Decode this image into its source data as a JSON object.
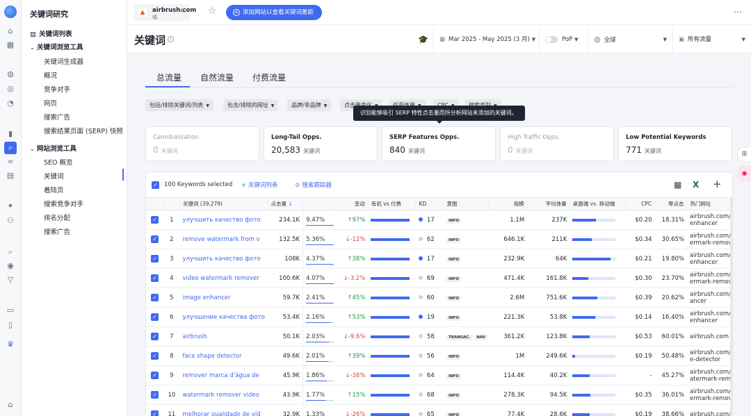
{
  "rail": {
    "icons": [
      "home-icon",
      "grid-icon",
      "globe-icon",
      "compass-icon",
      "pie-icon",
      "chart-icon",
      "keyword-icon",
      "link-icon",
      "doc-icon",
      "sparkle-icon",
      "group-icon",
      "search-zoom-icon",
      "target-icon",
      "funnel-icon",
      "report-icon",
      "clipboard-icon",
      "crown-icon",
      "settings-icon"
    ]
  },
  "sidenav": {
    "title": "关键词研究",
    "list_label": "关键词列表",
    "kw_tools": "关键词浏览工具",
    "kw_items": [
      "关键词生成器",
      "概况",
      "竞争对手",
      "网页",
      "搜索广告",
      "搜索结果页面 (SERP) 快照"
    ],
    "site_tools": "网站浏览工具",
    "site_items": [
      "SEO 概览",
      "关键词",
      "着陆页",
      "搜索竞争对手",
      "排名分配",
      "搜索广告"
    ]
  },
  "topbar": {
    "domain": "airbrush.com",
    "domain_sub": "域",
    "add_button": "添加网站以查看关键词差距"
  },
  "header": {
    "title": "关键词",
    "date_range": "Mar 2025 - May 2025 (3 月)",
    "pop": "PoP",
    "region": "全球",
    "traffic": "所有流量"
  },
  "tabs": [
    "总流量",
    "自然流量",
    "付费流量"
  ],
  "filters": [
    "包括/排除关键词/列表",
    "包含/排除的网址",
    "品牌/非品牌",
    "点击量变化",
    "任意体量",
    "CPC",
    "搜索类别"
  ],
  "tooltip": "识别能够吸引 SERP 特性点击量而所分析网站未添加的关键词。",
  "cards": [
    {
      "label": "Cannibalization",
      "value": "0",
      "unit": "关键词",
      "dim": true
    },
    {
      "label": "Long-Tail Opps.",
      "value": "20,583",
      "unit": "关键词",
      "dim": false
    },
    {
      "label": "SERP Features Opps.",
      "value": "840",
      "unit": "关键词",
      "dim": false
    },
    {
      "label": "High Traffic Opps.",
      "value": "0",
      "unit": "关键词",
      "dim": true
    },
    {
      "label": "Low Potential Keywords",
      "value": "771",
      "unit": "关键词",
      "dim": false
    }
  ],
  "toolbar": {
    "selected": "100 Keywords selected",
    "kw_list": "关键词列表",
    "tracker": "搜索跟踪器"
  },
  "columns": [
    "关键词 (39,279)",
    "点击量",
    "变动",
    "有机 vs 付费",
    "KD",
    "意图",
    "规模",
    "平均体量",
    "桌面端 vs. 移动端",
    "CPC",
    "零点击",
    "热门网址"
  ],
  "rows": [
    {
      "n": "1",
      "kw": "улучшить качество фото",
      "clicks": "234.1K",
      "share": "9.47%",
      "share_pct": 94.7,
      "chg": "97%",
      "dir": "up",
      "org": 100,
      "kd": "17",
      "kd_color": "#3f6af0",
      "intent": [
        "INFO"
      ],
      "scale": "1.1M",
      "vol": "237K",
      "desk": 55,
      "cpc": "$0.20",
      "zero": "18.31%",
      "url1": "airbrush.com/ru/",
      "url2": "enhancer"
    },
    {
      "n": "2",
      "kw": "remove watermark from v",
      "clicks": "132.5K",
      "share": "5.36%",
      "share_pct": 53.6,
      "chg": "-12%",
      "dir": "down",
      "org": 100,
      "kd": "62",
      "kd_color": "#c9d3ee",
      "intent": [
        "INFO"
      ],
      "scale": "646.1K",
      "vol": "211K",
      "desk": 45,
      "cpc": "$0.34",
      "zero": "30.65%",
      "url1": "airbrush.com/vid",
      "url2": "ermark-remover"
    },
    {
      "n": "3",
      "kw": "улучшить качество фото",
      "clicks": "108K",
      "share": "4.37%",
      "share_pct": 43.7,
      "chg": "38%",
      "dir": "up",
      "org": 100,
      "kd": "17",
      "kd_color": "#3f6af0",
      "intent": [
        "INFO"
      ],
      "scale": "232.9K",
      "vol": "64K",
      "desk": 88,
      "cpc": "$0.21",
      "zero": "19.80%",
      "url1": "airbrush.com/ru/",
      "url2": "enhancer"
    },
    {
      "n": "4",
      "kw": "video watermark remover",
      "clicks": "100.6K",
      "share": "4.07%",
      "share_pct": 40.7,
      "chg": "-3.2%",
      "dir": "down",
      "org": 100,
      "kd": "69",
      "kd_color": "#c9d3ee",
      "intent": [
        "INFO"
      ],
      "scale": "471.4K",
      "vol": "161.8K",
      "desk": 37,
      "cpc": "$0.30",
      "zero": "23.70%",
      "url1": "airbrush.com/vid",
      "url2": "ermark-remover"
    },
    {
      "n": "5",
      "kw": "image enhancer",
      "clicks": "59.7K",
      "share": "2.41%",
      "share_pct": 24.1,
      "chg": "45%",
      "dir": "up",
      "org": 100,
      "kd": "60",
      "kd_color": "#c9d3ee",
      "intent": [
        "INFO"
      ],
      "scale": "2.6M",
      "vol": "751.6K",
      "desk": 57,
      "cpc": "$0.39",
      "zero": "20.62%",
      "url1": "airbrush.com/ima",
      "url2": "ancer"
    },
    {
      "n": "6",
      "kw": "улучшение качества фото",
      "clicks": "53.4K",
      "share": "2.16%",
      "share_pct": 21.6,
      "chg": "53%",
      "dir": "up",
      "org": 100,
      "kd": "19",
      "kd_color": "#3f6af0",
      "intent": [
        "INFO"
      ],
      "scale": "221.3K",
      "vol": "53.8K",
      "desk": 52,
      "cpc": "$0.14",
      "zero": "16.40%",
      "url1": "airbrush.com/ru/",
      "url2": "enhancer"
    },
    {
      "n": "7",
      "kw": "airbrush",
      "clicks": "50.1K",
      "share": "2.03%",
      "share_pct": 20.3,
      "chg": "-9.6%",
      "dir": "down",
      "org": 100,
      "kd": "58",
      "kd_color": "#c9d3ee",
      "intent": [
        "TRANSAC.",
        "NAV"
      ],
      "scale": "361.2K",
      "vol": "123.8K",
      "desk": 40,
      "cpc": "$0.53",
      "zero": "60.01%",
      "url1": "airbrush.com",
      "url2": ""
    },
    {
      "n": "8",
      "kw": "face shape detector",
      "clicks": "49.6K",
      "share": "2.01%",
      "share_pct": 20.1,
      "chg": "39%",
      "dir": "up",
      "org": 100,
      "kd": "56",
      "kd_color": "#c9d3ee",
      "intent": [
        "INFO"
      ],
      "scale": "1M",
      "vol": "249.6K",
      "desk": 6,
      "cpc": "$0.19",
      "zero": "50.48%",
      "url1": "airbrush.com/fac",
      "url2": "e-detector"
    },
    {
      "n": "9",
      "kw": "remover marca d'água de",
      "clicks": "45.9K",
      "share": "1.86%",
      "share_pct": 18.6,
      "chg": "-38%",
      "dir": "down",
      "org": 100,
      "kd": "64",
      "kd_color": "#c9d3ee",
      "intent": [
        "INFO"
      ],
      "scale": "114.4K",
      "vol": "40.2K",
      "desk": 40,
      "cpc": "-",
      "zero": "45.27%",
      "url1": "airbrush.com/pt/",
      "url2": "atermark-remover"
    },
    {
      "n": "10",
      "kw": "watermark remover video",
      "clicks": "43.9K",
      "share": "1.77%",
      "share_pct": 17.7,
      "chg": "15%",
      "dir": "up",
      "org": 100,
      "kd": "68",
      "kd_color": "#c9d3ee",
      "intent": [
        "INFO"
      ],
      "scale": "278.3K",
      "vol": "94.5K",
      "desk": 42,
      "cpc": "$0.35",
      "zero": "36.01%",
      "url1": "airbrush.com/vid",
      "url2": "ermark-remover"
    },
    {
      "n": "11",
      "kw": "melhorar qualidade de víd",
      "clicks": "32.9K",
      "share": "1.33%",
      "share_pct": 13.3,
      "chg": "-26%",
      "dir": "down",
      "org": 100,
      "kd": "65",
      "kd_color": "#c9d3ee",
      "intent": [
        "INFO"
      ],
      "scale": "77.4K",
      "vol": "28.6K",
      "desk": 40,
      "cpc": "$0.19",
      "zero": "38.66%",
      "url1": "airbrush.com/pt/",
      "url2": ""
    }
  ]
}
